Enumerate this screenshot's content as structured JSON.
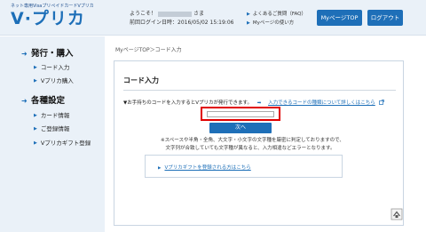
{
  "logo": {
    "tagline": "ネット専用VisaプリペイドカードVプリカ",
    "name": "V·プリカ"
  },
  "user": {
    "greeting_prefix": "ようこそ！",
    "greeting_suffix": "さま",
    "last_login_label": "前回ログイン日時：",
    "last_login": "2016/05/02 15:19:06"
  },
  "header_links": {
    "faq": "よくあるご質問（FAQ）",
    "howto": "Myページの使い方"
  },
  "buttons": {
    "mypage": "MyページTOP",
    "logout": "ログアウト"
  },
  "sidebar": {
    "sections": [
      {
        "title": "発行・購入",
        "items": [
          "コード入力",
          "Vプリカ購入"
        ]
      },
      {
        "title": "各種設定",
        "items": [
          "カード情報",
          "ご登録情報",
          "Vプリカギフト登録"
        ]
      }
    ]
  },
  "breadcrumb": "MyページTOP＞コード入力",
  "main": {
    "title": "コード入力",
    "description": "▼お手持ちのコードを入力するとVプリカが発行できます。",
    "code_link": "入力できるコードの種類について詳しくはこちら",
    "code_input_value": "",
    "code_input_placeholder": "",
    "next_button": "次へ",
    "note_line1": "※スペースや半角・全角、大文字・小文字の文字種を厳密に判定しておりますので、",
    "note_line2": "　文字列が合致していても文字種が異なると、入力相違などエラーとなります。",
    "gift_link": "Vプリカギフトを登録される方はこちら"
  },
  "icons": {
    "external_link": "external-link-icon",
    "page_top": "page-top-icon"
  },
  "colors": {
    "brand": "#1d6fb8",
    "button": "#1e6fb8",
    "highlight": "#e00000",
    "sidebar_bg": "#eaf1f8"
  }
}
